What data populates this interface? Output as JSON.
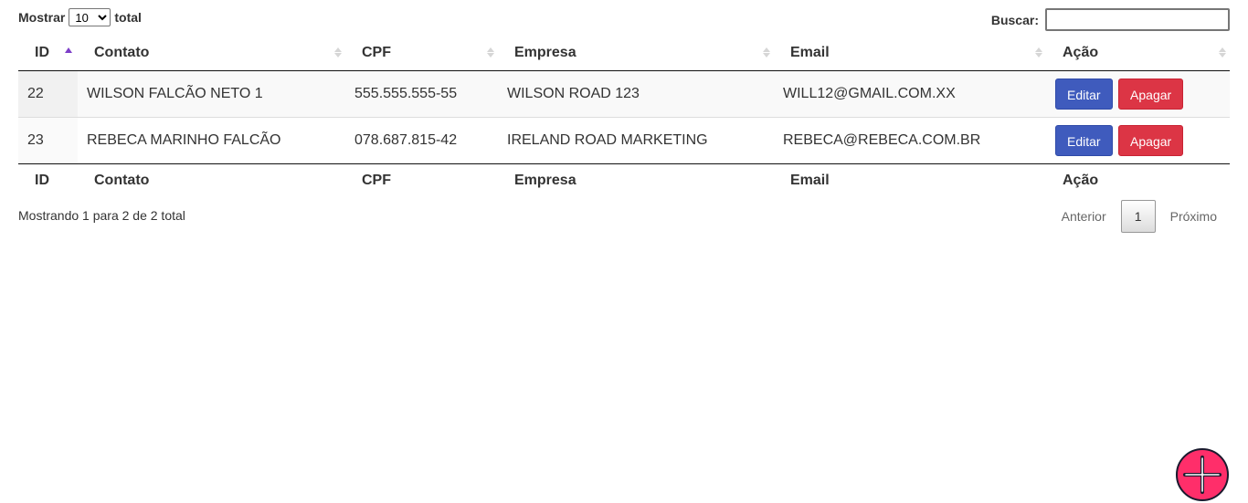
{
  "controls": {
    "length_prefix": "Mostrar",
    "length_value": "10",
    "length_suffix": "total",
    "search_label": "Buscar:",
    "search_value": ""
  },
  "table": {
    "columns": [
      "ID",
      "Contato",
      "CPF",
      "Empresa",
      "Email",
      "Ação"
    ],
    "rows": [
      {
        "id": "22",
        "contato": "WILSON FALCÃO NETO 1",
        "cpf": "555.555.555-55",
        "empresa": "WILSON ROAD 123",
        "email": "WILL12@GMAIL.COM.XX"
      },
      {
        "id": "23",
        "contato": "REBECA MARINHO FALCÃO",
        "cpf": "078.687.815-42",
        "empresa": "IRELAND ROAD MARKETING",
        "email": "REBECA@REBECA.COM.BR"
      }
    ],
    "edit_label": "Editar",
    "delete_label": "Apagar"
  },
  "info": "Mostrando 1 para 2 de 2 total",
  "paging": {
    "previous": "Anterior",
    "current": "1",
    "next": "Próximo"
  },
  "fab": {
    "icon": "plus-icon",
    "color": "#ff2e6a"
  }
}
